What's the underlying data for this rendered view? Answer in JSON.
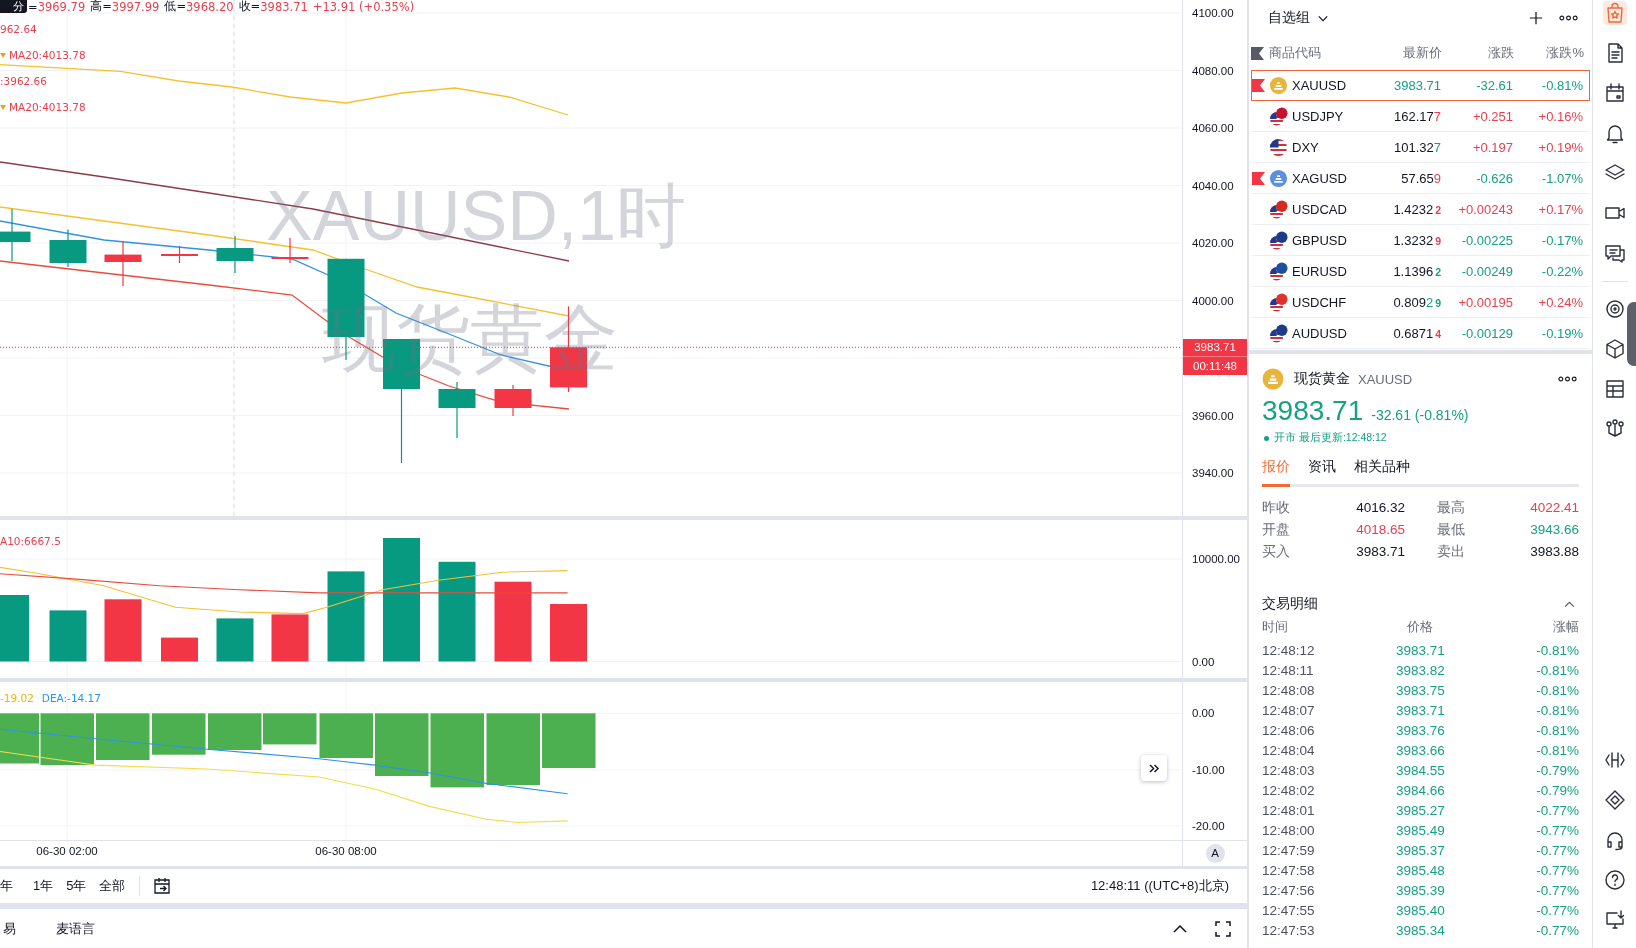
{
  "chart": {
    "legend": {
      "interval_badge": "分",
      "ohlc": [
        {
          "label": "=",
          "value": "3969.79"
        },
        {
          "label": "高=",
          "value": "3997.99"
        },
        {
          "label": "低=",
          "value": "3968.20"
        },
        {
          "label": "收=",
          "value": "3983.71"
        }
      ],
      "change": "+13.91 (+0.35%)",
      "indicators": [
        {
          "text": "962.64",
          "marker": false
        },
        {
          "text": "MA20:4013.78",
          "marker": true
        },
        {
          "text": ":3962.66",
          "marker": false
        },
        {
          "text": "MA20:4013.78",
          "marker": true
        }
      ]
    },
    "watermark": [
      "XAUUSD,1时",
      "现货黄金"
    ],
    "price_axis": {
      "ticks": [
        "4100.00",
        "4080.00",
        "4060.00",
        "4040.00",
        "4020.00",
        "4000.00",
        "3960.00",
        "3940.00"
      ],
      "last_price": "3983.71",
      "countdown": "00:11:48"
    },
    "volume": {
      "legend": "A10:6667.5",
      "ticks": [
        "10000.00",
        "0.00"
      ]
    },
    "macd": {
      "legend": [
        {
          "text": "-19.02",
          "kind": "macd"
        },
        {
          "text": "DEA:-14.17",
          "kind": "signal"
        }
      ],
      "ticks": [
        "0.00",
        "-10.00",
        "-20.00"
      ]
    },
    "time_axis": {
      "ticks": [
        "06-30 02:00",
        "06-30 08:00"
      ],
      "scale_button": "A"
    }
  },
  "range_bar": {
    "ranges": [
      "年",
      "1年",
      "5年",
      "全部"
    ],
    "clock": "12:48:11 ((UTC+8)北京)"
  },
  "bottom_panel": {
    "tabs": [
      "易",
      "麦语言"
    ]
  },
  "watchlist": {
    "group": "自选组",
    "columns": [
      "商品代码",
      "最新价",
      "涨跌",
      "涨跌%"
    ],
    "rows": [
      {
        "symbol": "XAUUSD",
        "selected": true,
        "flagged": true,
        "icon": {
          "kind": "coin",
          "color": "#e9b43c"
        },
        "price": [
          {
            "text": "3983.71",
            "color": "#17a084",
            "small": false
          }
        ],
        "change": "-32.61",
        "percent": "-0.81%",
        "color": "#17a084"
      },
      {
        "symbol": "USDJPY",
        "selected": false,
        "flagged": false,
        "icon": {
          "kind": "pair",
          "color": "#c8102e"
        },
        "price": [
          {
            "text": "162.17",
            "color": "#131722",
            "small": false
          },
          {
            "text": "7",
            "color": "#e8404f",
            "small": false
          }
        ],
        "change": "+0.251",
        "percent": "+0.16%",
        "color": "#e8404f"
      },
      {
        "symbol": "DXY",
        "selected": false,
        "flagged": false,
        "icon": {
          "kind": "flag"
        },
        "price": [
          {
            "text": "101.32",
            "color": "#131722",
            "small": false
          },
          {
            "text": "7",
            "color": "#17a084",
            "small": false
          }
        ],
        "change": "+0.197",
        "percent": "+0.19%",
        "color": "#e8404f"
      },
      {
        "symbol": "XAGUSD",
        "selected": false,
        "flagged": true,
        "icon": {
          "kind": "coin",
          "color": "#5b8fe0"
        },
        "price": [
          {
            "text": "57.65",
            "color": "#131722",
            "small": false
          },
          {
            "text": "9",
            "color": "#e8404f",
            "small": false
          }
        ],
        "change": "-0.626",
        "percent": "-1.07%",
        "color": "#17a084"
      },
      {
        "symbol": "USDCAD",
        "selected": false,
        "flagged": false,
        "icon": {
          "kind": "pair",
          "color": "#d52b1e"
        },
        "price": [
          {
            "text": "1.4232",
            "color": "#131722",
            "small": false
          },
          {
            "text": "2",
            "color": "#e8404f",
            "small": true
          }
        ],
        "change": "+0.00243",
        "percent": "+0.17%",
        "color": "#e8404f"
      },
      {
        "symbol": "GBPUSD",
        "selected": false,
        "flagged": false,
        "icon": {
          "kind": "pair",
          "color": "#1c3b8a"
        },
        "price": [
          {
            "text": "1.3232",
            "color": "#131722",
            "small": false
          },
          {
            "text": "9",
            "color": "#e8404f",
            "small": true
          }
        ],
        "change": "-0.00225",
        "percent": "-0.17%",
        "color": "#17a084"
      },
      {
        "symbol": "EURUSD",
        "selected": false,
        "flagged": false,
        "icon": {
          "kind": "pair",
          "color": "#1d4fa0"
        },
        "price": [
          {
            "text": "1.1396",
            "color": "#131722",
            "small": false
          },
          {
            "text": "2",
            "color": "#17a084",
            "small": true
          }
        ],
        "change": "-0.00249",
        "percent": "-0.22%",
        "color": "#17a084"
      },
      {
        "symbol": "USDCHF",
        "selected": false,
        "flagged": false,
        "icon": {
          "kind": "pair",
          "color": "#e0322c"
        },
        "price": [
          {
            "text": "0.809",
            "color": "#131722",
            "small": false
          },
          {
            "text": "2",
            "color": "#17a084",
            "small": false
          },
          {
            "text": "9",
            "color": "#17a084",
            "small": true
          }
        ],
        "change": "+0.00195",
        "percent": "+0.24%",
        "color": "#e8404f"
      },
      {
        "symbol": "AUDUSD",
        "selected": false,
        "flagged": false,
        "icon": {
          "kind": "pair",
          "color": "#1c3b8a"
        },
        "price": [
          {
            "text": "0.6871",
            "color": "#131722",
            "small": false
          },
          {
            "text": "4",
            "color": "#e8404f",
            "small": true
          }
        ],
        "change": "-0.00129",
        "percent": "-0.19%",
        "color": "#17a084"
      }
    ]
  },
  "detail": {
    "icon": {
      "kind": "coin",
      "color": "#e9b43c"
    },
    "name": "现货黄金",
    "symbol": "XAUUSD",
    "price": "3983.71",
    "change": "-32.61 (-0.81%)",
    "color": "#17a084",
    "market_open": true,
    "status": "开市 最后更新:12:48:12",
    "tabs": [
      {
        "label": "报价",
        "selected": true
      },
      {
        "label": "资讯",
        "selected": false
      },
      {
        "label": "相关品种",
        "selected": false
      }
    ],
    "stats": [
      {
        "label": "昨收",
        "value": "4016.32",
        "color": "#131722"
      },
      {
        "label": "最高",
        "value": "4022.41",
        "color": "#e8404f"
      },
      {
        "label": "开盘",
        "value": "4018.65",
        "color": "#e8404f"
      },
      {
        "label": "最低",
        "value": "3943.66",
        "color": "#17a084"
      },
      {
        "label": "买入",
        "value": "3983.71",
        "color": "#131722"
      },
      {
        "label": "卖出",
        "value": "3983.88",
        "color": "#131722"
      }
    ]
  },
  "trades": {
    "title": "交易明细",
    "expanded": true,
    "columns": [
      "时间",
      "价格",
      "涨幅"
    ],
    "rows": [
      {
        "time": "12:48:12",
        "price": "3983.71",
        "percent": "-0.81%",
        "color": "#17a084"
      },
      {
        "time": "12:48:11",
        "price": "3983.82",
        "percent": "-0.81%",
        "color": "#17a084"
      },
      {
        "time": "12:48:08",
        "price": "3983.75",
        "percent": "-0.81%",
        "color": "#17a084"
      },
      {
        "time": "12:48:07",
        "price": "3983.71",
        "percent": "-0.81%",
        "color": "#17a084"
      },
      {
        "time": "12:48:06",
        "price": "3983.76",
        "percent": "-0.81%",
        "color": "#17a084"
      },
      {
        "time": "12:48:04",
        "price": "3983.66",
        "percent": "-0.81%",
        "color": "#17a084"
      },
      {
        "time": "12:48:03",
        "price": "3984.55",
        "percent": "-0.79%",
        "color": "#17a084"
      },
      {
        "time": "12:48:02",
        "price": "3984.66",
        "percent": "-0.79%",
        "color": "#17a084"
      },
      {
        "time": "12:48:01",
        "price": "3985.27",
        "percent": "-0.77%",
        "color": "#17a084"
      },
      {
        "time": "12:48:00",
        "price": "3985.49",
        "percent": "-0.77%",
        "color": "#17a084"
      },
      {
        "time": "12:47:59",
        "price": "3985.37",
        "percent": "-0.77%",
        "color": "#17a084"
      },
      {
        "time": "12:47:58",
        "price": "3985.48",
        "percent": "-0.77%",
        "color": "#17a084"
      },
      {
        "time": "12:47:56",
        "price": "3985.39",
        "percent": "-0.77%",
        "color": "#17a084"
      },
      {
        "time": "12:47:55",
        "price": "3985.40",
        "percent": "-0.77%",
        "color": "#17a084"
      },
      {
        "time": "12:47:53",
        "price": "3985.34",
        "percent": "-0.77%",
        "color": "#17a084"
      }
    ]
  },
  "side_toolbar": {
    "groups": [
      [
        {
          "kind": "star-bag",
          "selected": true
        },
        {
          "kind": "document",
          "selected": false
        },
        {
          "kind": "calendar",
          "selected": false
        },
        {
          "kind": "bell",
          "selected": false
        },
        {
          "kind": "layers",
          "selected": false
        },
        {
          "kind": "video-camera",
          "selected": false
        },
        {
          "kind": "chat",
          "selected": false
        }
      ],
      [
        {
          "kind": "target",
          "selected": false
        },
        {
          "kind": "cube",
          "selected": false
        },
        {
          "kind": "table",
          "selected": false
        },
        {
          "kind": "nodes",
          "selected": false
        }
      ],
      [
        {
          "kind": "brackets",
          "selected": false
        },
        {
          "kind": "diamond",
          "selected": false
        },
        {
          "kind": "headset",
          "selected": false
        },
        {
          "kind": "help",
          "selected": false
        },
        {
          "kind": "download",
          "selected": false
        }
      ]
    ]
  }
}
